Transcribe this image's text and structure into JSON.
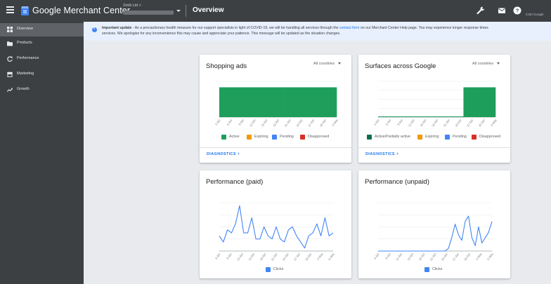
{
  "topbar": {
    "brand": "Google Merchant Center",
    "account_name": "Zeldi Ltd >",
    "page_title": "Overview",
    "account_right": "C3Ei Google"
  },
  "sidebar": {
    "items": [
      {
        "label": "Overview",
        "icon": "grid-icon",
        "active": true
      },
      {
        "label": "Products",
        "icon": "folder-icon",
        "active": false
      },
      {
        "label": "Performance",
        "icon": "refresh-icon",
        "active": false
      },
      {
        "label": "Marketing",
        "icon": "store-icon",
        "active": false
      },
      {
        "label": "Growth",
        "icon": "trending-up-icon",
        "active": false
      }
    ]
  },
  "banner": {
    "bold": "Important update",
    "line1_a": " - As a precautionary health measure for our support specialists in light of COVID-19, we will be handling all services through the ",
    "link": "contact form",
    "line1_b": " on our Merchant Center Help page. You may experience longer response times",
    "line2": "services. We apologise for any inconvenience this may cause and appreciate your patience. This message will be updated as the situation changes."
  },
  "cards": {
    "shopping": {
      "title": "Shopping ads",
      "dropdown": "All countries",
      "diagnostics": "DIAGNOSTICS",
      "legend": [
        {
          "label": "Active",
          "color": "#1e9e5a"
        },
        {
          "label": "Expiring",
          "color": "#f29900"
        },
        {
          "label": "Pending",
          "color": "#4285f4"
        },
        {
          "label": "Disapproved",
          "color": "#d93025"
        }
      ]
    },
    "surfaces": {
      "title": "Surfaces across Google",
      "dropdown": "All countries",
      "diagnostics": "DIAGNOSTICS",
      "legend": [
        {
          "label": "Active/Partially active",
          "color": "#0b6e4f"
        },
        {
          "label": "Expiring",
          "color": "#f29900"
        },
        {
          "label": "Pending",
          "color": "#4285f4"
        },
        {
          "label": "Disapproved",
          "color": "#d93025"
        }
      ]
    },
    "paid": {
      "title": "Performance (paid)",
      "legend": [
        {
          "label": "Clicks",
          "color": "#4285f4"
        }
      ]
    },
    "unpaid": {
      "title": "Performance (unpaid)",
      "legend": [
        {
          "label": "Clicks",
          "color": "#4285f4"
        }
      ]
    }
  },
  "chart_data": [
    {
      "type": "bar",
      "name": "Shopping ads",
      "x": [
        "3 Apr",
        "6 Apr",
        "9 Apr",
        "12 Apr",
        "15 Apr",
        "18 Apr",
        "21 Apr",
        "24 Apr",
        "27 Apr",
        "30 Apr",
        "3 May"
      ],
      "series": [
        {
          "name": "Active",
          "color": "#1e9e5a",
          "values": [
            1,
            1,
            1,
            1,
            1,
            1,
            1,
            1,
            1,
            1,
            1
          ]
        }
      ],
      "ylim": [
        0,
        1.2
      ],
      "grid": true
    },
    {
      "type": "area",
      "name": "Surfaces across Google",
      "x": [
        "3 Apr",
        "6 Apr",
        "9 Apr",
        "12 Apr",
        "15 Apr",
        "18 Apr",
        "21 Apr",
        "24 Apr",
        "27 Apr",
        "30 Apr",
        "3 May"
      ],
      "series": [
        {
          "name": "Active/Partially active",
          "color": "#1e9e5a",
          "values": [
            0,
            0,
            0,
            0,
            0,
            0,
            0,
            0,
            1,
            1,
            1
          ]
        }
      ],
      "ylim": [
        0,
        1.2
      ],
      "grid": true
    },
    {
      "type": "line",
      "name": "Performance (paid)",
      "x": [
        "6 Apr",
        "9 Apr",
        "12 Apr",
        "15 Apr",
        "18 Apr",
        "21 Apr",
        "24 Apr",
        "27 Apr",
        "30 Apr",
        "3 May",
        "6 May"
      ],
      "series": [
        {
          "name": "Clicks",
          "color": "#4285f4",
          "values": [
            5,
            3,
            7,
            6,
            9,
            15,
            6,
            6,
            11,
            4,
            4,
            8,
            5,
            4,
            8,
            4,
            3,
            7,
            8,
            5,
            3,
            1,
            5,
            6,
            9,
            5,
            11,
            5,
            6
          ]
        }
      ],
      "ylim": [
        0,
        16
      ],
      "grid": true
    },
    {
      "type": "line",
      "name": "Performance (unpaid)",
      "x": [
        "6 Apr",
        "9 Apr",
        "12 Apr",
        "15 Apr",
        "18 Apr",
        "21 Apr",
        "24 Apr",
        "27 Apr",
        "30 Apr",
        "3 May",
        "6 May"
      ],
      "series": [
        {
          "name": "Clicks",
          "color": "#4285f4",
          "values": [
            0,
            0,
            0,
            0,
            0,
            0,
            0,
            0,
            0,
            0,
            0,
            0,
            0,
            0,
            0,
            0,
            0,
            0,
            0,
            0,
            0,
            1,
            5,
            10,
            6,
            4,
            11,
            13,
            5,
            2,
            9,
            3,
            5,
            7,
            11
          ]
        }
      ],
      "ylim": [
        0,
        18
      ],
      "grid": true
    }
  ]
}
